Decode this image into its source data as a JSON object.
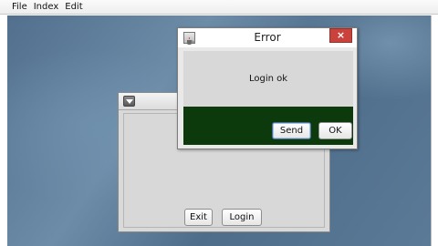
{
  "menubar": {
    "items": [
      "File",
      "Index",
      "Edit"
    ]
  },
  "back_window": {
    "buttons": {
      "exit": "Exit",
      "login": "Login"
    }
  },
  "error_dialog": {
    "title": "Error",
    "close_glyph": "×",
    "message": "Login ok",
    "buttons": {
      "send": "Send",
      "ok": "OK"
    }
  },
  "icons": {
    "window_menu": "triangle-down-icon",
    "dialog_app": "java-cup-icon",
    "close": "close-icon"
  },
  "colors": {
    "desktop": "#5b7a97",
    "dialog_bottom": "#0c3a0c",
    "close_button": "#c9423c"
  }
}
